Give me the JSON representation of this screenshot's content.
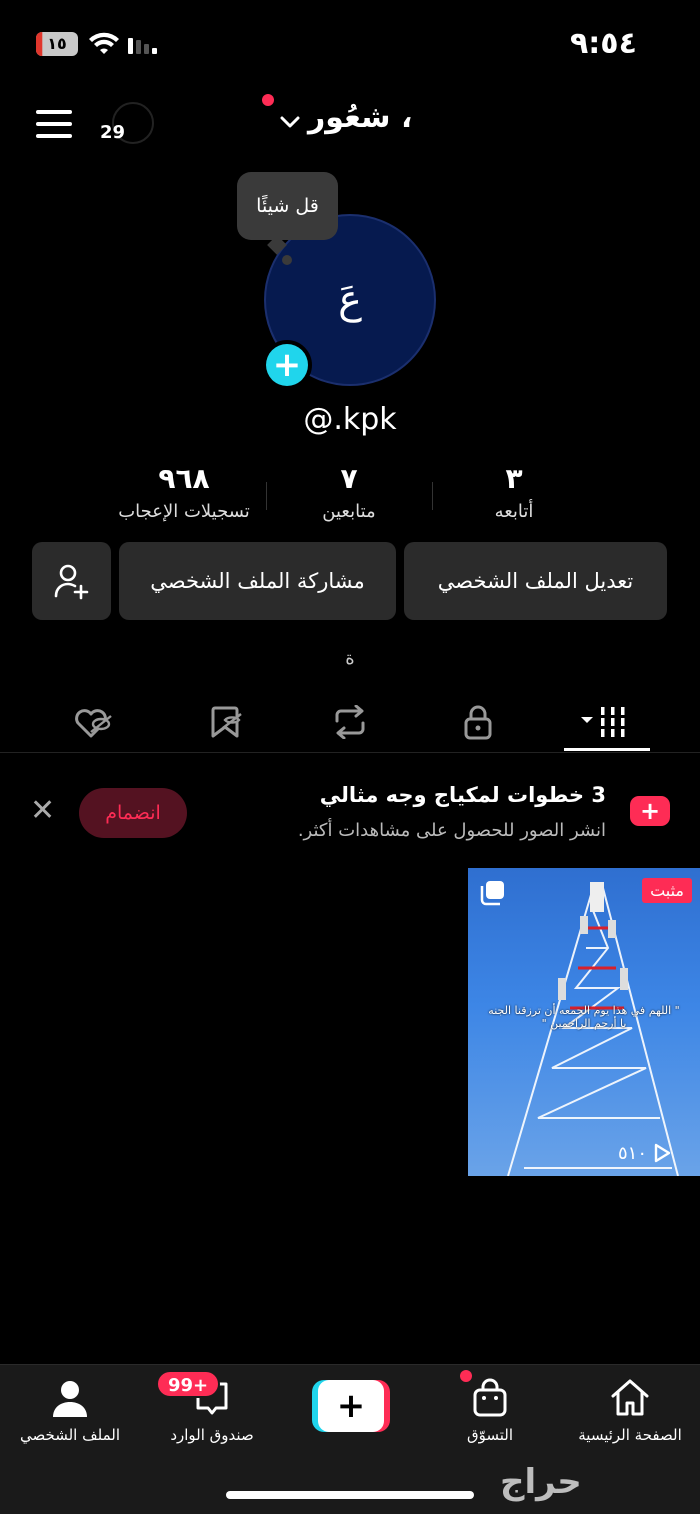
{
  "status_bar": {
    "battery": "١٥",
    "battery_level": 0.15,
    "time": "٩:٥٤"
  },
  "header": {
    "title": "شعُور ،",
    "friends_count": "29",
    "menu_icon": "hamburger-menu-icon"
  },
  "profile": {
    "avatar_letter": "عَ",
    "speech_bubble": "قل شيئًا",
    "username": "@.kpk",
    "bio": "ة"
  },
  "stats": {
    "following": {
      "value": "٣",
      "label": "أتابعه"
    },
    "followers": {
      "value": "٧",
      "label": "متابعين"
    },
    "likes": {
      "value": "٩٦٨",
      "label": "تسجيلات الإعجاب"
    }
  },
  "actions": {
    "edit_profile": "تعديل الملف الشخصي",
    "share_profile": "مشاركة الملف الشخصي",
    "add_friend_icon": "add-user-icon"
  },
  "tabs": [
    "videos-grid-icon",
    "lock-icon",
    "repost-icon",
    "hidden-favorites-icon",
    "hidden-liked-icon"
  ],
  "promo": {
    "title": "3 خطوات لمكياج وجه مثالي",
    "subtitle": "انشر الصور للحصول على مشاهدات أكثر.",
    "join": "انضمام"
  },
  "video": {
    "pinned": "مثبت",
    "caption": "\" اللهم في هذا يوم الجمعه أن ترزقنا الجنه يا أرحم الراحمين \"",
    "views": "٥١٠"
  },
  "bottom_nav": {
    "home": "الصفحة الرئيسية",
    "shop": "التسوّق",
    "inbox": "صندوق الوارد",
    "inbox_badge": "99+",
    "profile": "الملف الشخصي"
  },
  "watermark": "حراج",
  "colors": {
    "accent": "#fe2c55",
    "cyan": "#20d5ec",
    "avatar_bg": "#061a4f"
  }
}
